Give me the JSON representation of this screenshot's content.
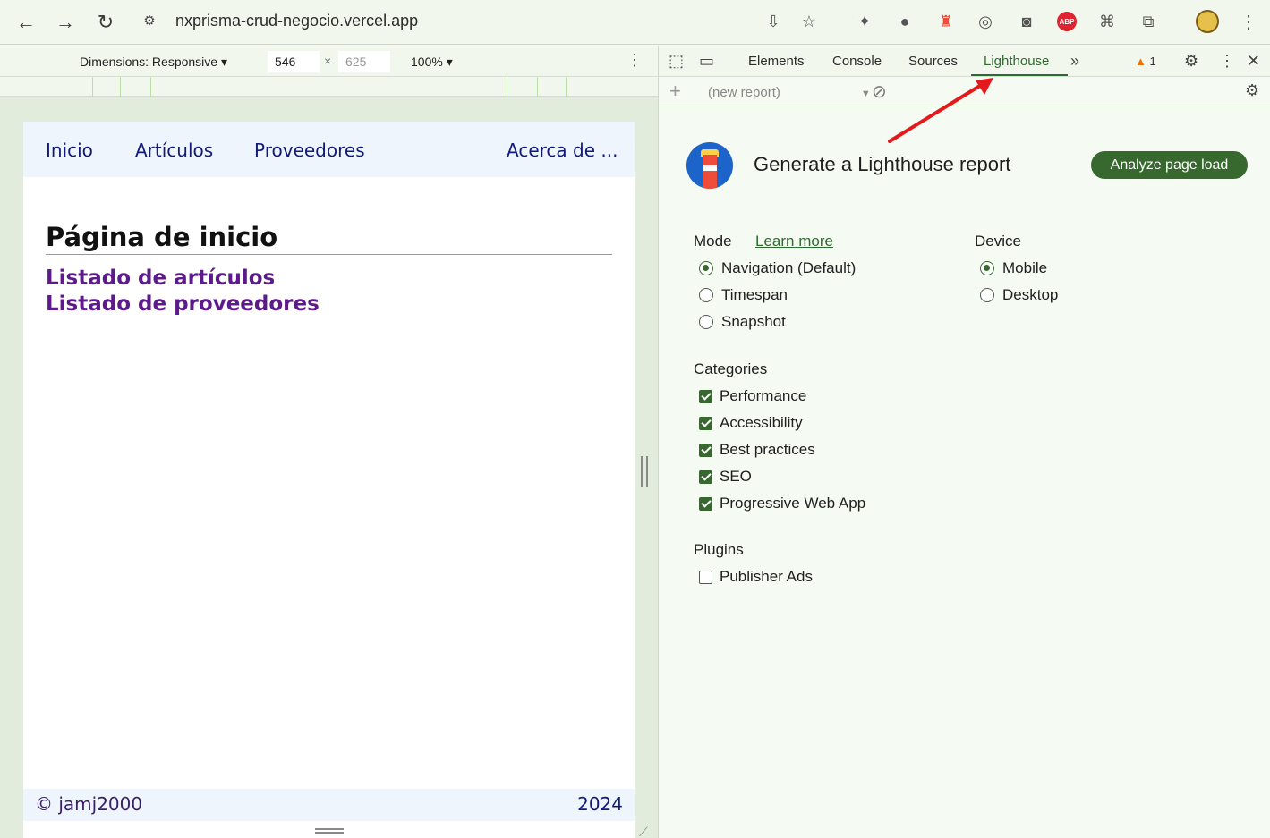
{
  "browser": {
    "url": "nxprisma-crud-negocio.vercel.app",
    "extensions": [
      "install-icon",
      "star-icon",
      "extension-a-icon",
      "extension-b-icon",
      "extension-c-icon",
      "extension-d-icon",
      "camera-icon",
      "abp-icon",
      "extension-e-icon",
      "puzzle-icon"
    ],
    "abp_label": "ABP"
  },
  "device_toolbar": {
    "dimensions_label": "Dimensions: Responsive",
    "width": "546",
    "height": "625",
    "times": "×",
    "zoom": "100%"
  },
  "site": {
    "nav": [
      "Inicio",
      "Artículos",
      "Proveedores",
      "Acerca de ..."
    ],
    "title": "Página de inicio",
    "links": [
      "Listado de artículos",
      "Listado de proveedores"
    ],
    "footer_left": "© jamj2000",
    "footer_right": "2024"
  },
  "devtools": {
    "tabs": [
      "Elements",
      "Console",
      "Sources",
      "Lighthouse"
    ],
    "active_tab": "Lighthouse",
    "warning_count": "1",
    "report_select": "(new report)"
  },
  "lighthouse": {
    "title": "Generate a Lighthouse report",
    "analyze_label": "Analyze page load",
    "mode_label": "Mode",
    "learn_more": "Learn more",
    "modes": [
      "Navigation (Default)",
      "Timespan",
      "Snapshot"
    ],
    "device_label": "Device",
    "devices": [
      "Mobile",
      "Desktop"
    ],
    "categories_label": "Categories",
    "categories": [
      "Performance",
      "Accessibility",
      "Best practices",
      "SEO",
      "Progressive Web App"
    ],
    "plugins_label": "Plugins",
    "plugins": [
      "Publisher Ads"
    ]
  },
  "colors": {
    "accent": "#37692f",
    "annotation_arrow": "#e5191b"
  }
}
